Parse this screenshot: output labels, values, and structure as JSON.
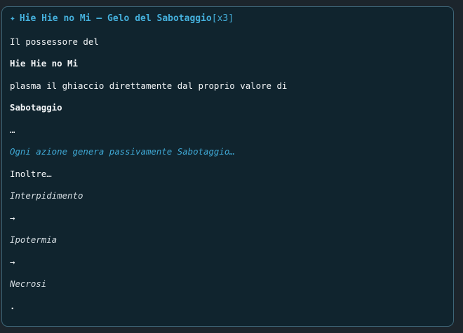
{
  "card": {
    "title_icon": "sparkle-icon",
    "title_icon_glyph": "✦",
    "title": "Hie Hie no Mi – Gelo del Sabotaggio",
    "title_count": "[x3]",
    "lines": [
      "Il possessore del",
      "Hie Hie no Mi",
      "plasma il ghiaccio direttamente dal proprio valore di",
      "Sabotaggio",
      "…",
      "Ogni azione genera passivamente Sabotaggio…",
      "Inoltre…",
      "Interpidimento",
      "→",
      "Ipotermia",
      "→",
      "Necrosi",
      "."
    ]
  },
  "colors": {
    "background": "#1c252c",
    "card_background": "#10242e",
    "card_border": "#3d6577",
    "accent": "#45b0dc",
    "text": "#f2f5f7"
  }
}
